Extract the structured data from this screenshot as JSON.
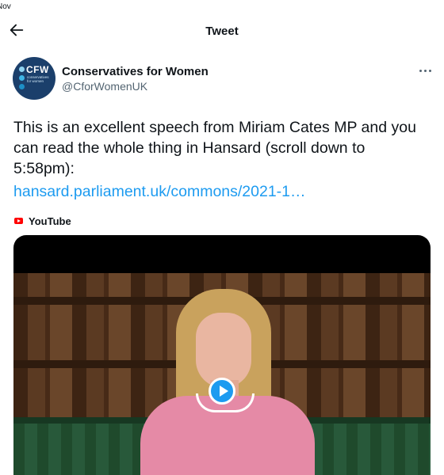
{
  "status": {
    "month": "Nov"
  },
  "header": {
    "title": "Tweet",
    "back_icon": "arrow-left-icon"
  },
  "author": {
    "display_name": "Conservatives for Women",
    "handle": "@CforWomenUK",
    "avatar_text": "CFW",
    "avatar_subtext": "conservatives for women",
    "avatar_color": "#1b3f6b"
  },
  "tweet": {
    "text": "This is an excellent speech from Miriam Cates MP and you can read the whole thing in Hansard (scroll down to 5:58pm):",
    "link": "hansard.parliament.uk/commons/2021-1…",
    "link_color": "#1d9bf0"
  },
  "media": {
    "source_label": "YouTube",
    "source_icon": "youtube-icon",
    "play_icon": "play-icon",
    "play_color": "#1d9bf0"
  }
}
